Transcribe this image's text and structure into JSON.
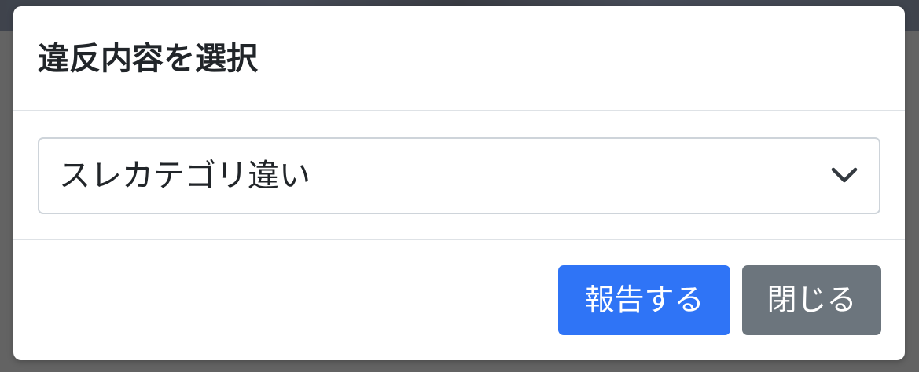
{
  "modal": {
    "title": "違反内容を選択",
    "select": {
      "selected_value": "スレカテゴリ違い",
      "icon": "chevron-down-icon"
    },
    "buttons": {
      "report_label": "報告する",
      "close_label": "閉じる"
    }
  },
  "colors": {
    "primary": "#2f74f6",
    "secondary": "#6c757d",
    "border": "#dee2e6",
    "text": "#212529"
  }
}
